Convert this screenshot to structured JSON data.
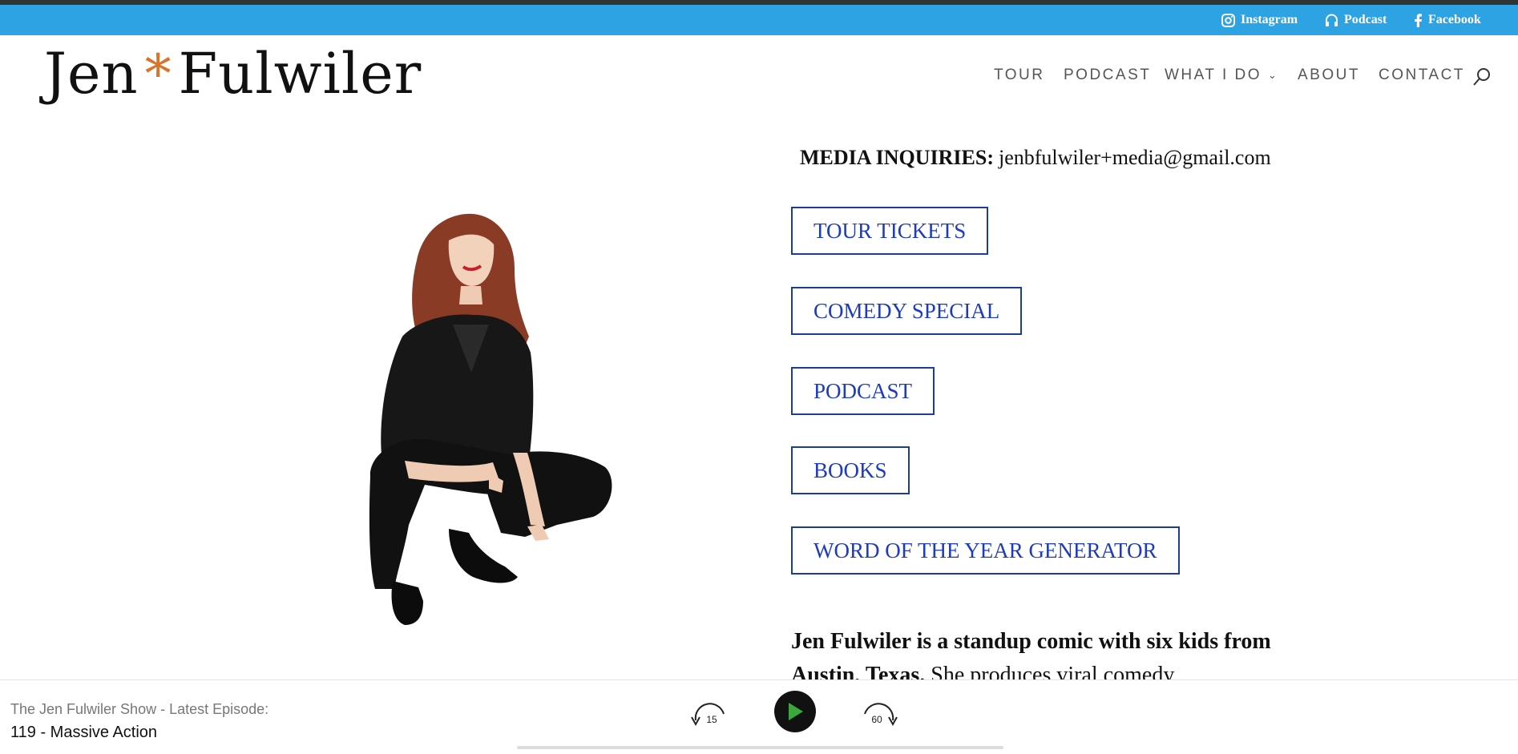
{
  "top_bar": {
    "links": [
      {
        "label": "Instagram",
        "icon": "instagram-icon"
      },
      {
        "label": "Podcast",
        "icon": "headphones-icon"
      },
      {
        "label": "Facebook",
        "icon": "facebook-icon"
      }
    ],
    "color": "#2ea3e3"
  },
  "header": {
    "logo": {
      "first": "Jen",
      "star": "*",
      "last": "Fulwiler",
      "star_color": "#d9732a"
    },
    "nav": [
      "TOUR",
      "PODCAST",
      "WHAT I DO",
      "ABOUT",
      "CONTACT"
    ],
    "search_icon": "search-icon"
  },
  "main": {
    "media_label": "MEDIA INQUIRIES:",
    "media_email": "jenbfulwiler+media@gmail.com",
    "buttons": [
      "TOUR TICKETS",
      "COMEDY SPECIAL",
      "PODCAST",
      "BOOKS",
      "WORD OF THE YEAR GENERATOR"
    ],
    "bio_bold": "Jen Fulwiler is a standup comic with six kids from Austin, Texas.",
    "bio_rest": " She produces viral comedy"
  },
  "player": {
    "show_label": "The Jen Fulwiler Show - Latest Episode:",
    "episode_title": "119 - Massive Action",
    "rewind_seconds": "15",
    "forward_seconds": "60",
    "play_color": "#3aa83a"
  }
}
